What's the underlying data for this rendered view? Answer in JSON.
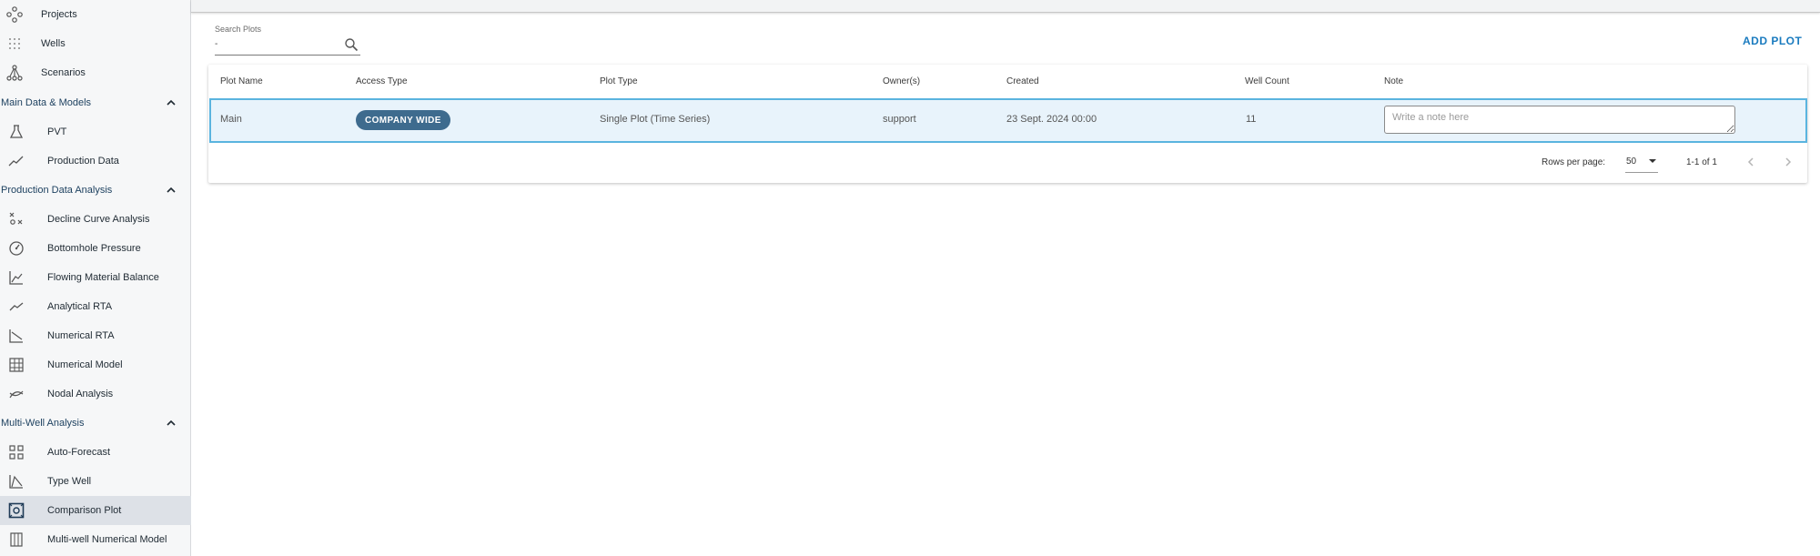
{
  "sidebar": {
    "top_items": [
      {
        "label": "Projects",
        "icon": "projects-network-icon"
      },
      {
        "label": "Wells",
        "icon": "wells-grid-icon"
      },
      {
        "label": "Scenarios",
        "icon": "scenarios-tree-icon"
      }
    ],
    "sections": [
      {
        "title": "Main Data & Models",
        "items": [
          {
            "label": "PVT",
            "icon": "flask-icon"
          },
          {
            "label": "Production Data",
            "icon": "line-trend-icon"
          }
        ]
      },
      {
        "title": "Production Data Analysis",
        "items": [
          {
            "label": "Decline Curve Analysis",
            "icon": "decline-curve-icon"
          },
          {
            "label": "Bottomhole Pressure",
            "icon": "gauge-icon"
          },
          {
            "label": "Flowing Material Balance",
            "icon": "fmb-chart-icon"
          },
          {
            "label": "Analytical RTA",
            "icon": "analytical-line-icon"
          },
          {
            "label": "Numerical RTA",
            "icon": "numerical-rta-icon"
          },
          {
            "label": "Numerical Model",
            "icon": "grid-model-icon"
          },
          {
            "label": "Nodal Analysis",
            "icon": "nodal-curves-icon"
          }
        ]
      },
      {
        "title": "Multi-Well Analysis",
        "items": [
          {
            "label": "Auto-Forecast",
            "icon": "four-squares-icon"
          },
          {
            "label": "Type Well",
            "icon": "type-well-curve-icon"
          },
          {
            "label": "Comparison Plot",
            "icon": "comparison-plot-icon",
            "active": true
          },
          {
            "label": "Multi-well Numerical Model",
            "icon": "columns-icon"
          }
        ]
      }
    ]
  },
  "search": {
    "label": "Search Plots",
    "value": "-"
  },
  "actions": {
    "add_plot": "ADD PLOT"
  },
  "table": {
    "headers": {
      "plot_name": "Plot Name",
      "access_type": "Access Type",
      "plot_type": "Plot Type",
      "owners": "Owner(s)",
      "created": "Created",
      "well_count": "Well Count",
      "note": "Note"
    },
    "rows": [
      {
        "plot_name": "Main",
        "access_type": "COMPANY WIDE",
        "plot_type": "Single Plot (Time Series)",
        "owners": "support",
        "created": "23 Sept. 2024 00:00",
        "well_count": "11",
        "note_placeholder": "Write a note here"
      }
    ]
  },
  "pagination": {
    "rows_per_page_label": "Rows per page:",
    "rows_per_page": "50",
    "range": "1-1 of 1"
  },
  "colors": {
    "accent": "#1a7bbf",
    "badge": "#3e6b8e",
    "row_highlight": "#e8f3fb",
    "row_border": "#5ab4df",
    "section_title": "#1b3f5e"
  }
}
